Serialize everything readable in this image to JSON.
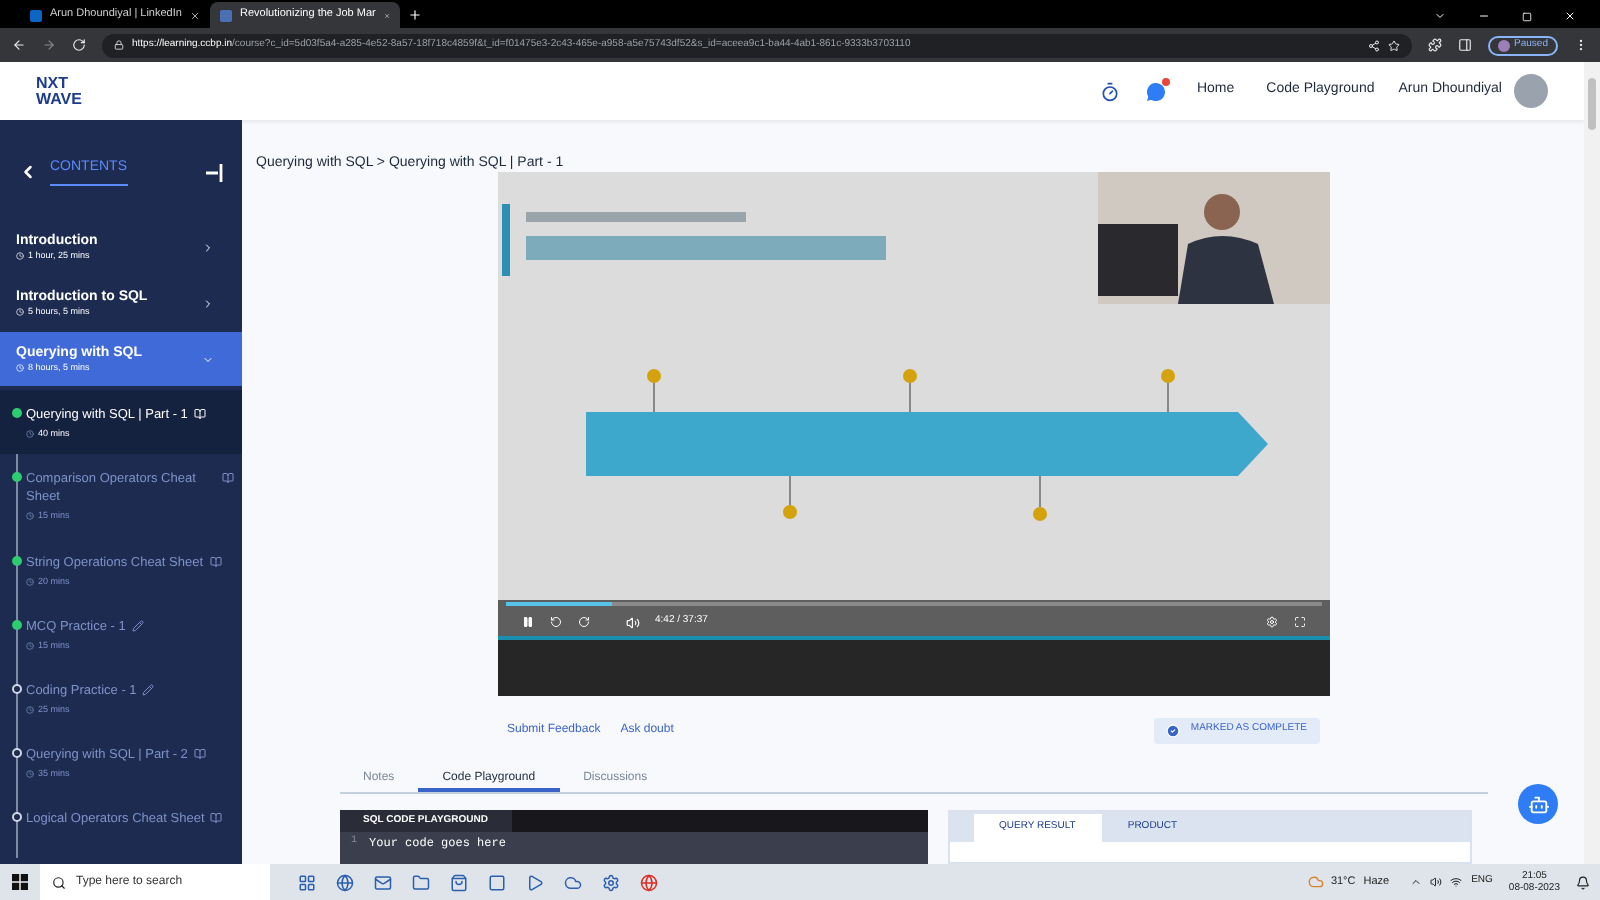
{
  "browser": {
    "tabs": [
      {
        "title": "Arun Dhoundiyal | LinkedIn",
        "selected": false,
        "kind": "linkedin"
      },
      {
        "title": "Revolutionizing the Job Mar",
        "selected": true,
        "kind": "site"
      }
    ],
    "url_host": "https://learning.ccbp.in",
    "url_path": "/course?c_id=5d03f5a4-a285-4e52-8a57-18f718c4859f&t_id=f01475e3-2c43-465e-a958-a5e75743df52&s_id=aceea9c1-ba44-4ab1-861c-9333b3703110",
    "profile": "Paused"
  },
  "header": {
    "logo_top": "NXT",
    "logo_bottom": "WAVE",
    "nav": [
      "Home",
      "Code Playground"
    ],
    "user": "Arun Dhoundiyal",
    "notification": true
  },
  "sidebar": {
    "title": "CONTENTS",
    "modules": [
      {
        "title": "Introduction",
        "duration": "1 hour, 25 mins",
        "expanded": false
      },
      {
        "title": "Introduction to SQL",
        "duration": "5 hours, 5 mins",
        "expanded": false
      },
      {
        "title": "Querying with SQL",
        "duration": "8 hours, 5 mins",
        "expanded": true
      }
    ],
    "lessons": [
      {
        "title": "Querying with SQL | Part - 1",
        "duration": "40 mins",
        "kind": "reading",
        "completed": true,
        "selected": true
      },
      {
        "title": "Comparison Operators Cheat Sheet",
        "duration": "15 mins",
        "kind": "reading",
        "completed": true,
        "selected": false
      },
      {
        "title": "String Operations Cheat Sheet",
        "duration": "20 mins",
        "kind": "reading",
        "completed": true,
        "selected": false
      },
      {
        "title": "MCQ Practice - 1",
        "duration": "15 mins",
        "kind": "practice",
        "completed": true,
        "selected": false
      },
      {
        "title": "Coding Practice - 1",
        "duration": "25 mins",
        "kind": "practice",
        "completed": false,
        "selected": false
      },
      {
        "title": "Querying with SQL | Part - 2",
        "duration": "35 mins",
        "kind": "reading",
        "completed": false,
        "selected": false
      },
      {
        "title": "Logical Operators Cheat Sheet",
        "kind": "reading",
        "completed": false,
        "selected": false
      }
    ]
  },
  "breadcrumb": "Querying with SQL > Querying with SQL | Part - 1",
  "player": {
    "kind": "picture",
    "time": "4:42 / 37:37",
    "level": 0.13,
    "playing": true
  },
  "actions": {
    "feedback": "Submit Feedback",
    "doubt": "Ask doubt",
    "complete": "MARKED AS COMPLETE"
  },
  "tabs": [
    {
      "label": "Notes",
      "selected": false
    },
    {
      "label": "Code Playground",
      "selected": true
    },
    {
      "label": "Discussions",
      "selected": false
    }
  ],
  "editor": {
    "title": "SQL CODE PLAYGROUND",
    "line_number": "1",
    "code": "Your code goes here"
  },
  "result_tabs": [
    {
      "label": "QUERY RESULT",
      "selected": true
    },
    {
      "label": "PRODUCT",
      "selected": false
    }
  ],
  "taskbar": {
    "search_placeholder": "Type here to search",
    "temperature": "31°C",
    "weather": "Haze",
    "lang": "ENG",
    "time": "21:05",
    "date": "08-08-2023"
  }
}
